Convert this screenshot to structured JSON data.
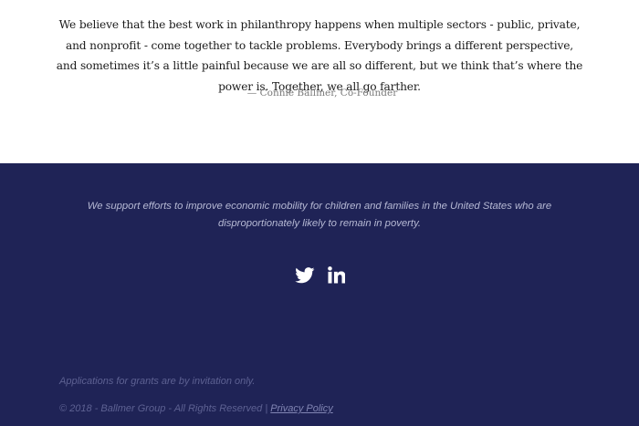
{
  "quote": {
    "text": "We believe that the best work in philanthropy happens when multiple sectors - public, private, and nonprofit - come together to tackle problems. Everybody brings a different perspective, and sometimes it’s a little painful because we are all so different, but we think that’s where the power is. Together, we all go farther.",
    "attribution": "— Connie Ballmer, Co-Founder"
  },
  "footer": {
    "background_color": "#1f2356",
    "mission": "We support efforts to improve economic mobility for children and families in the United States who are disproportionately likely to remain in poverty.",
    "social": [
      {
        "name": "twitter-icon"
      },
      {
        "name": "linkedin-icon"
      }
    ],
    "grants_note": "Applications for grants are by invitation only.",
    "copyright": "© 2018 - Ballmer Group - All Rights Reserved",
    "separator": "|",
    "privacy_link": "Privacy Policy"
  }
}
